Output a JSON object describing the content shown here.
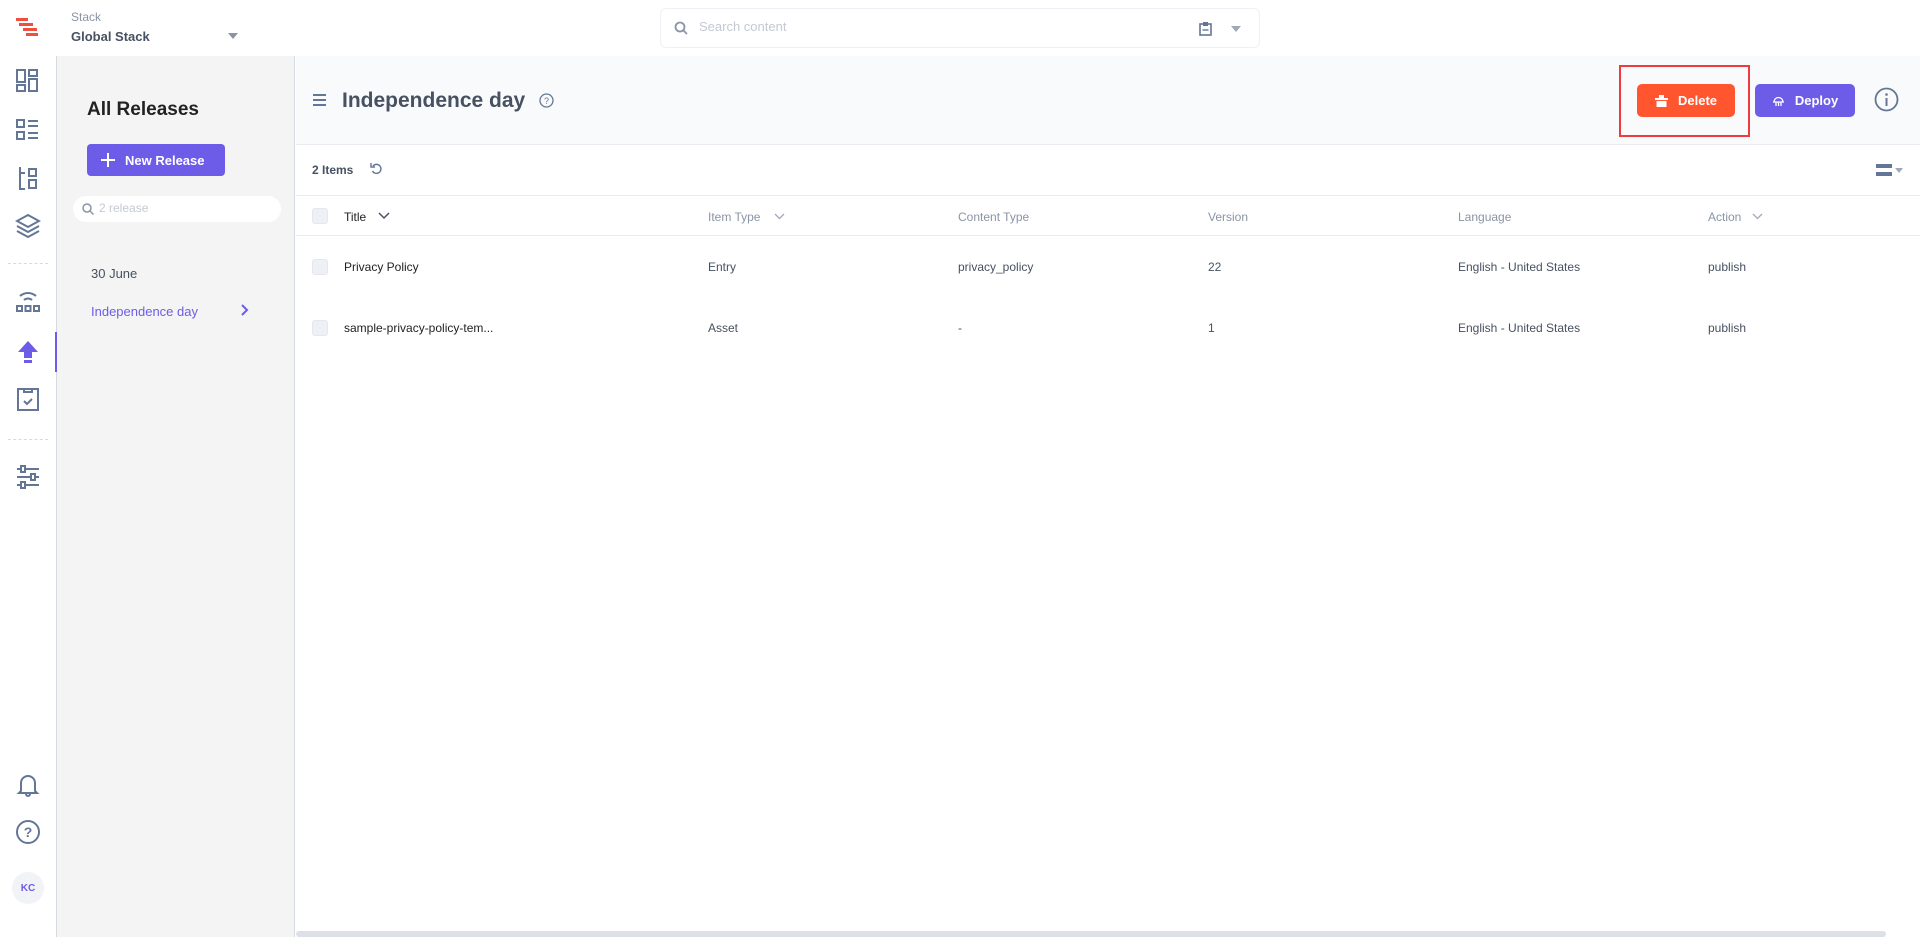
{
  "topbar": {
    "stack_label": "Stack",
    "stack_name": "Global Stack",
    "search_placeholder": "Search content"
  },
  "rail": {
    "avatar_initials": "KC",
    "icons": [
      "dashboard-icon",
      "entries-icon",
      "content-models-icon",
      "assets-icon",
      "extensions-icon",
      "releases-icon",
      "workflow-tasks-icon",
      "settings-icon",
      "notifications-icon",
      "help-icon"
    ]
  },
  "sidebar": {
    "title": "All Releases",
    "new_release_label": "New Release",
    "search_placeholder": "2 release",
    "releases": [
      {
        "label": "30 June",
        "active": false
      },
      {
        "label": "Independence day",
        "active": true
      }
    ]
  },
  "main": {
    "title": "Independence day",
    "delete_label": "Delete",
    "deploy_label": "Deploy",
    "items_count": "2 Items",
    "columns": [
      "Title",
      "Item Type",
      "Content Type",
      "Version",
      "Language",
      "Action"
    ],
    "rows": [
      {
        "title": "Privacy Policy",
        "item_type": "Entry",
        "content_type": "privacy_policy",
        "version": "22",
        "language": "English - United States",
        "action": "publish"
      },
      {
        "title": "sample-privacy-policy-tem...",
        "item_type": "Asset",
        "content_type": "-",
        "version": "1",
        "language": "English - United States",
        "action": "publish"
      }
    ]
  },
  "colors": {
    "accent": "#6c5ce7",
    "delete": "#ff5630",
    "highlight": "#f03a3e"
  }
}
